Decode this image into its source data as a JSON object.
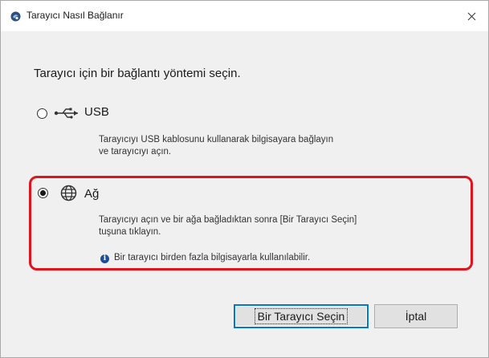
{
  "window": {
    "title": "Tarayıcı Nasıl Bağlanır",
    "close_symbol": "×"
  },
  "dialog": {
    "instruction": "Tarayıcı için bir bağlantı yöntemi seçin.",
    "options": [
      {
        "label": "USB",
        "icon": "usb-icon",
        "selected": false,
        "description_line1": "Tarayıcıyı USB kablosunu kullanarak bilgisayara bağlayın",
        "description_line2": "ve tarayıcıyı açın."
      },
      {
        "label": "Ağ",
        "icon": "globe-icon",
        "selected": true,
        "description_line1": "Tarayıcıyı açın ve bir ağa bağladıktan sonra [Bir Tarayıcı Seçin]",
        "description_line2": "tuşuna tıklayın.",
        "note": "Bir tarayıcı birden fazla bilgisayarla kullanılabilir."
      }
    ],
    "highlight_color": "#e0141e"
  },
  "buttons": {
    "select_scanner": "Bir Tarayıcı Seçin",
    "cancel": "İptal"
  }
}
